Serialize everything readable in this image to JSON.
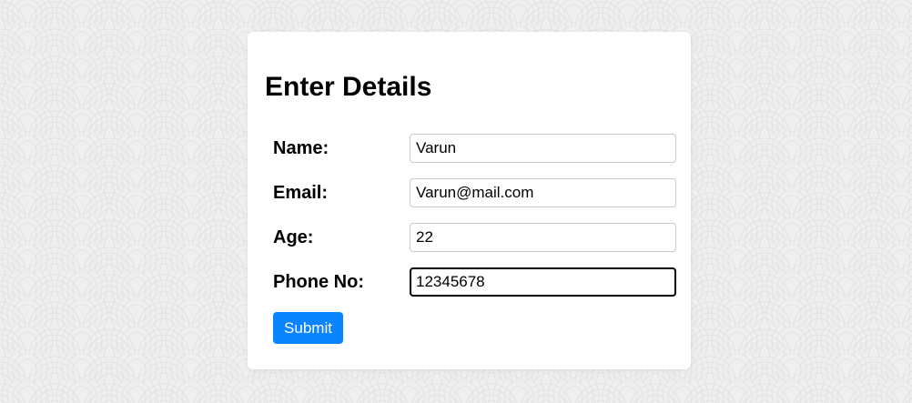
{
  "form": {
    "title": "Enter Details",
    "fields": [
      {
        "label": "Name:",
        "value": "Varun"
      },
      {
        "label": "Email:",
        "value": "Varun@mail.com"
      },
      {
        "label": "Age:",
        "value": "22"
      },
      {
        "label": "Phone No:",
        "value": "12345678",
        "focused": true
      }
    ],
    "submit_label": "Submit"
  },
  "colors": {
    "accent": "#0a84ff",
    "background": "#efefef",
    "card": "#ffffff"
  }
}
